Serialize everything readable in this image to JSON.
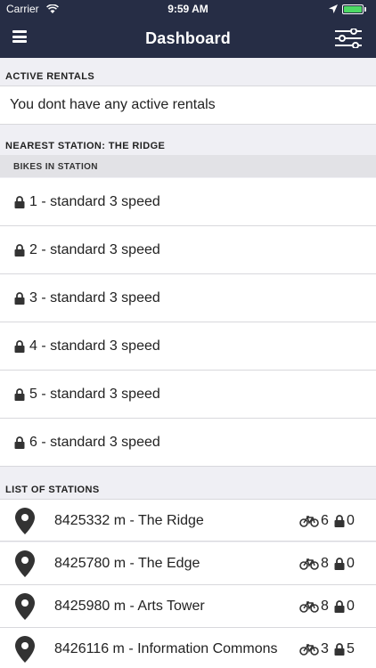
{
  "status_bar": {
    "carrier": "Carrier",
    "time": "9:59 AM"
  },
  "nav": {
    "title": "Dashboard"
  },
  "active_rentals": {
    "header": "ACTIVE RENTALS",
    "message": "You dont have any active rentals"
  },
  "nearest_station": {
    "header": "NEAREST STATION: THE RIDGE",
    "bikes_header": "BIKES IN STATION",
    "bikes": [
      {
        "label": "1 - standard 3 speed"
      },
      {
        "label": "2 - standard 3 speed"
      },
      {
        "label": "3 - standard 3 speed"
      },
      {
        "label": "4 - standard 3 speed"
      },
      {
        "label": "5 - standard 3 speed"
      },
      {
        "label": "6 - standard 3 speed"
      }
    ]
  },
  "stations": {
    "header": "LIST OF STATIONS",
    "items": [
      {
        "name": "8425332 m - The Ridge",
        "bikes": "6",
        "locks": "0"
      },
      {
        "name": "8425780 m - The Edge",
        "bikes": "8",
        "locks": "0"
      },
      {
        "name": "8425980 m - Arts Tower",
        "bikes": "8",
        "locks": "0"
      },
      {
        "name": "8426116 m - Information Commons",
        "bikes": "3",
        "locks": "5"
      }
    ]
  },
  "colors": {
    "nav_bg": "#262d45",
    "battery": "#4cd964"
  },
  "icons": [
    "wifi-icon",
    "location-arrow-icon",
    "battery-icon",
    "menu-icon",
    "filter-icon",
    "lock-icon",
    "map-pin-icon",
    "bicycle-icon"
  ]
}
